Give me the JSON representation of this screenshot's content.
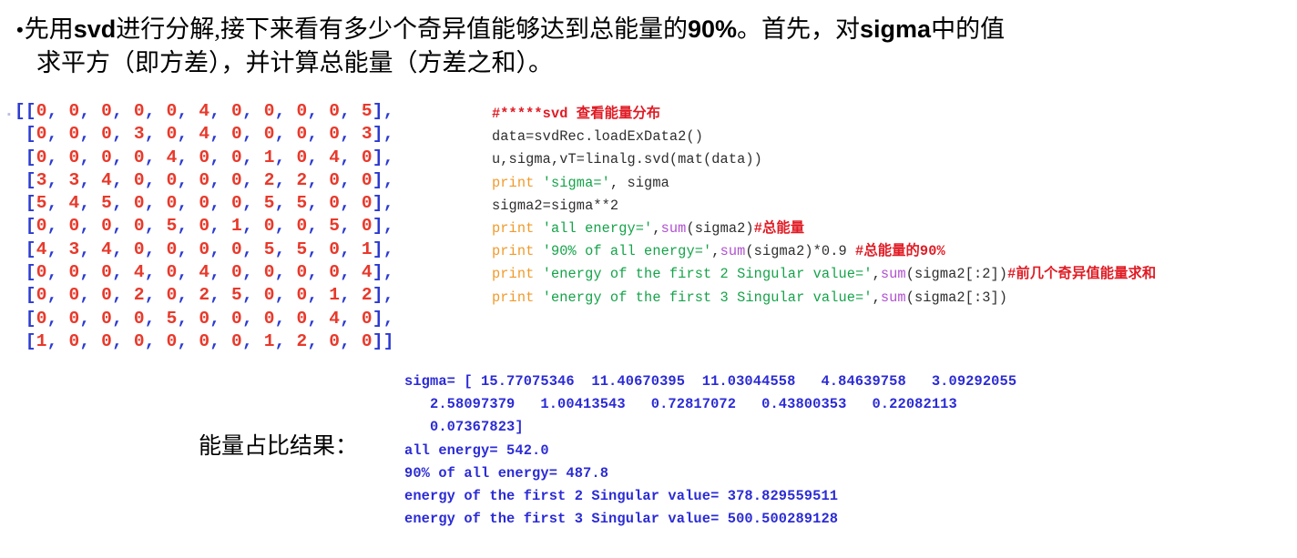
{
  "slide": {
    "background_color": "#ffffff",
    "title": {
      "bullet": "•",
      "line1": "先用svd进行分解,接下来看有多少个奇异值能够达到总能量的90%。首先，对sigma中的值",
      "line2": "求平方（即方差），并计算总能量（方差之和）。",
      "line1_parts": [
        {
          "t": "先用",
          "bold": false
        },
        {
          "t": "svd",
          "bold": true
        },
        {
          "t": "进行分解,接下来看有多少个奇异值能够达到总能量的",
          "bold": false
        },
        {
          "t": "90%",
          "bold": true
        },
        {
          "t": "。首先，对",
          "bold": false
        },
        {
          "t": "sigma",
          "bold": true
        },
        {
          "t": "中的值",
          "bold": false
        }
      ]
    },
    "result_label": "能量占比结果："
  },
  "matrix": {
    "name": "loadExData2-matrix",
    "open": "[[",
    "close": "]]",
    "row_open": "[",
    "row_close": "],",
    "separator": ", ",
    "rows": [
      [
        0,
        0,
        0,
        0,
        0,
        4,
        0,
        0,
        0,
        0,
        5
      ],
      [
        0,
        0,
        0,
        3,
        0,
        4,
        0,
        0,
        0,
        0,
        3
      ],
      [
        0,
        0,
        0,
        0,
        4,
        0,
        0,
        1,
        0,
        4,
        0
      ],
      [
        3,
        3,
        4,
        0,
        0,
        0,
        0,
        2,
        2,
        0,
        0
      ],
      [
        5,
        4,
        5,
        0,
        0,
        0,
        0,
        5,
        5,
        0,
        0
      ],
      [
        0,
        0,
        0,
        0,
        5,
        0,
        1,
        0,
        0,
        5,
        0
      ],
      [
        4,
        3,
        4,
        0,
        0,
        0,
        0,
        5,
        5,
        0,
        1
      ],
      [
        0,
        0,
        0,
        4,
        0,
        4,
        0,
        0,
        0,
        0,
        4
      ],
      [
        0,
        0,
        0,
        2,
        0,
        2,
        5,
        0,
        0,
        1,
        2
      ],
      [
        0,
        0,
        0,
        0,
        5,
        0,
        0,
        0,
        0,
        4,
        0
      ],
      [
        1,
        0,
        0,
        0,
        0,
        0,
        0,
        1,
        2,
        0,
        0
      ]
    ],
    "digit_color": "#e8392b",
    "bracket_color": "#2b3ad1"
  },
  "code": {
    "language": "python",
    "colors": {
      "comment": "#e01b24",
      "keyword": "#f09a2b",
      "string": "#16a34a",
      "builtin": "#b050d0",
      "plain": "#2e2e2e"
    },
    "lines": [
      [
        {
          "tok": "comment",
          "t": "#*****svd 查看能量分布"
        }
      ],
      [
        {
          "tok": "plain",
          "t": "data=svdRec.loadExData2()"
        }
      ],
      [
        {
          "tok": "plain",
          "t": "u,sigma,vT=linalg.svd(mat(data))"
        }
      ],
      [
        {
          "tok": "keyword",
          "t": "print"
        },
        {
          "tok": "plain",
          "t": " "
        },
        {
          "tok": "string",
          "t": "'sigma='"
        },
        {
          "tok": "plain",
          "t": ", sigma"
        }
      ],
      [
        {
          "tok": "plain",
          "t": "sigma2=sigma**2"
        }
      ],
      [
        {
          "tok": "keyword",
          "t": "print"
        },
        {
          "tok": "plain",
          "t": " "
        },
        {
          "tok": "string",
          "t": "'all energy='"
        },
        {
          "tok": "plain",
          "t": ","
        },
        {
          "tok": "builtin",
          "t": "sum"
        },
        {
          "tok": "plain",
          "t": "(sigma2)"
        },
        {
          "tok": "comment",
          "t": "#总能量"
        }
      ],
      [
        {
          "tok": "keyword",
          "t": "print"
        },
        {
          "tok": "plain",
          "t": " "
        },
        {
          "tok": "string",
          "t": "'90% of all energy='"
        },
        {
          "tok": "plain",
          "t": ","
        },
        {
          "tok": "builtin",
          "t": "sum"
        },
        {
          "tok": "plain",
          "t": "(sigma2)*0.9 "
        },
        {
          "tok": "comment",
          "t": "#总能量的90%"
        }
      ],
      [
        {
          "tok": "keyword",
          "t": "print"
        },
        {
          "tok": "plain",
          "t": " "
        },
        {
          "tok": "string",
          "t": "'energy of the first 2 Singular value='"
        },
        {
          "tok": "plain",
          "t": ","
        },
        {
          "tok": "builtin",
          "t": "sum"
        },
        {
          "tok": "plain",
          "t": "(sigma2[:2])"
        },
        {
          "tok": "comment",
          "t": "#前几个奇异值能量求和"
        }
      ],
      [
        {
          "tok": "keyword",
          "t": "print"
        },
        {
          "tok": "plain",
          "t": " "
        },
        {
          "tok": "string",
          "t": "'energy of the first 3 Singular value='"
        },
        {
          "tok": "plain",
          "t": ","
        },
        {
          "tok": "builtin",
          "t": "sum"
        },
        {
          "tok": "plain",
          "t": "(sigma2[:3])"
        }
      ]
    ]
  },
  "output": {
    "color": "#2b2bd6",
    "lines": [
      "sigma= [ 15.77075346  11.40670395  11.03044558   4.84639758   3.09292055",
      "   2.58097379   1.00413543   0.72817072   0.43800353   0.22082113",
      "   0.07367823]",
      "all energy= 542.0",
      "90% of all energy= 487.8",
      "energy of the first 2 Singular value= 378.829559511",
      "energy of the first 3 Singular value= 500.500289128"
    ],
    "values": {
      "sigma": [
        15.77075346,
        11.40670395,
        11.03044558,
        4.84639758,
        3.09292055,
        2.58097379,
        1.00413543,
        0.72817072,
        0.43800353,
        0.22082113,
        0.07367823
      ],
      "all_energy": 542.0,
      "ninety_percent_of_all_energy": 487.8,
      "energy_first_2": 378.829559511,
      "energy_first_3": 500.500289128
    }
  }
}
